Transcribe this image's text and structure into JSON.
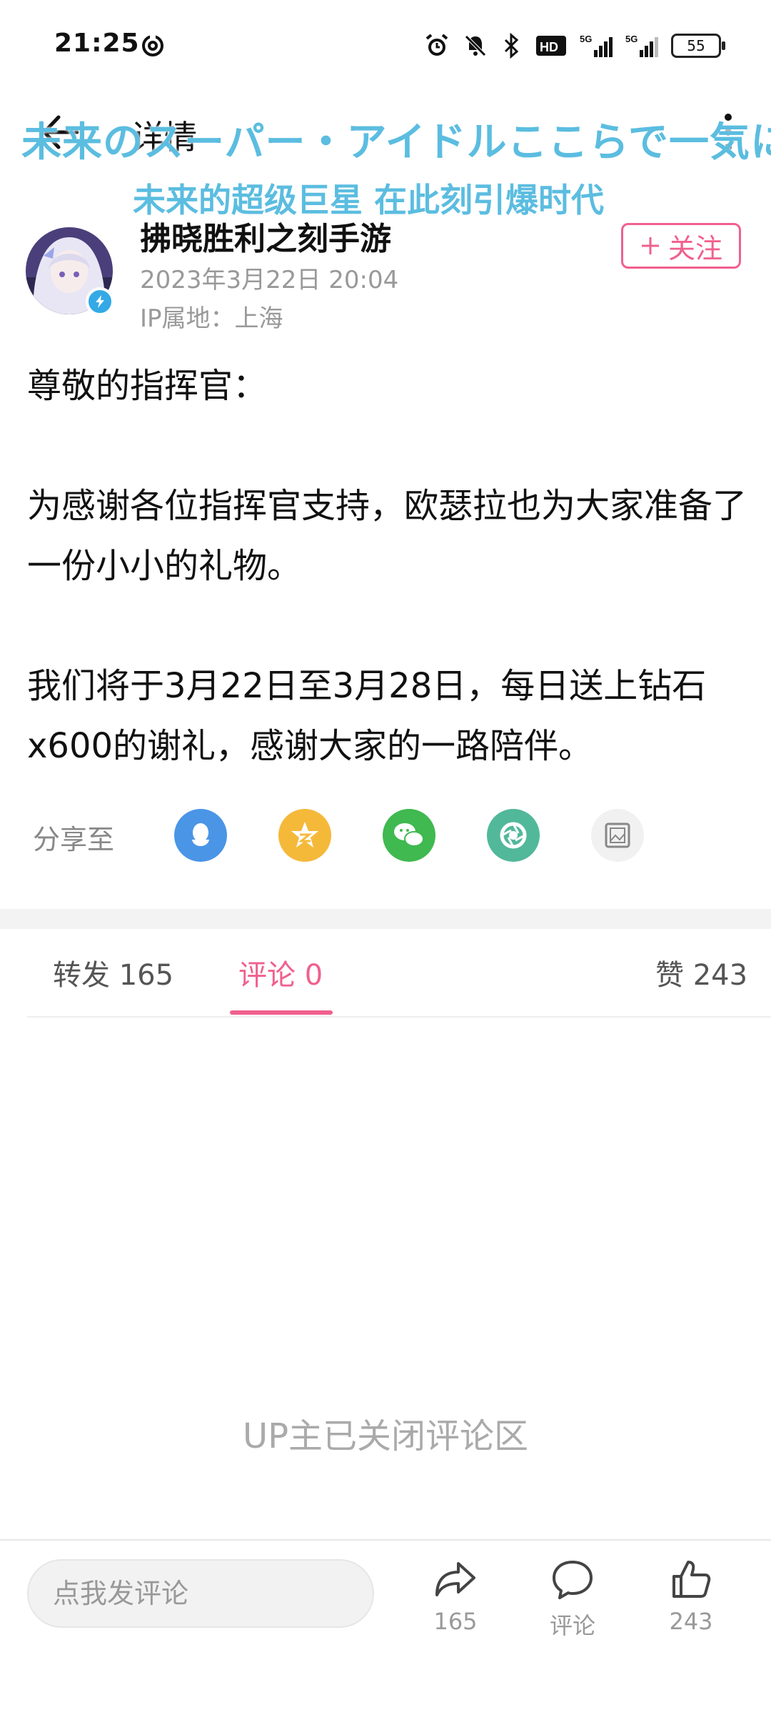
{
  "status_bar": {
    "time": "21:25",
    "battery": "55",
    "icons": [
      "sync-icon",
      "alarm-icon",
      "mute-icon",
      "bluetooth-icon",
      "hd-icon",
      "signal-5g-icon",
      "signal-5g-icon",
      "battery-icon"
    ]
  },
  "header": {
    "title": "详情",
    "back_icon": "back-arrow-icon",
    "more_icon": "more-vertical-icon"
  },
  "banner": {
    "jp_text": "未来のスーパー・アイドルここらで一気に",
    "cn_text": "未来的超级巨星  在此刻引爆时代"
  },
  "author": {
    "name": "拂晓胜利之刻手游",
    "time": "2023年3月22日 20:04",
    "ip": "IP属地：上海",
    "follow_label": "关注",
    "verified": true
  },
  "post": {
    "lines": [
      "尊敬的指挥官：",
      "",
      "为感谢各位指挥官支持，欧瑟拉也为大家准备了一份小小的礼物。",
      "",
      "我们将于3月22日至3月28日，每日送上钻石x600的谢礼，感谢大家的一路陪伴。"
    ]
  },
  "share": {
    "label": "分享至",
    "targets": [
      {
        "name": "qq-icon",
        "color": "#4a95e6"
      },
      {
        "name": "qzone-icon",
        "color": "#f5b93a"
      },
      {
        "name": "wechat-icon",
        "color": "#3fb950"
      },
      {
        "name": "moments-icon",
        "color": "#52b89a"
      },
      {
        "name": "save-image-icon",
        "color": "#f1f1f1"
      }
    ]
  },
  "tabs": {
    "repost": "转发 165",
    "comments": "评论 0",
    "likes": "赞 243"
  },
  "comments_area": {
    "closed_notice": "UP主已关闭评论区"
  },
  "bottom_bar": {
    "input_placeholder": "点我发评论",
    "share_count": "165",
    "comment_label": "评论",
    "like_count": "243"
  },
  "colors": {
    "accent": "#f0608e",
    "banner": "#5bbde0",
    "muted": "#999999"
  }
}
